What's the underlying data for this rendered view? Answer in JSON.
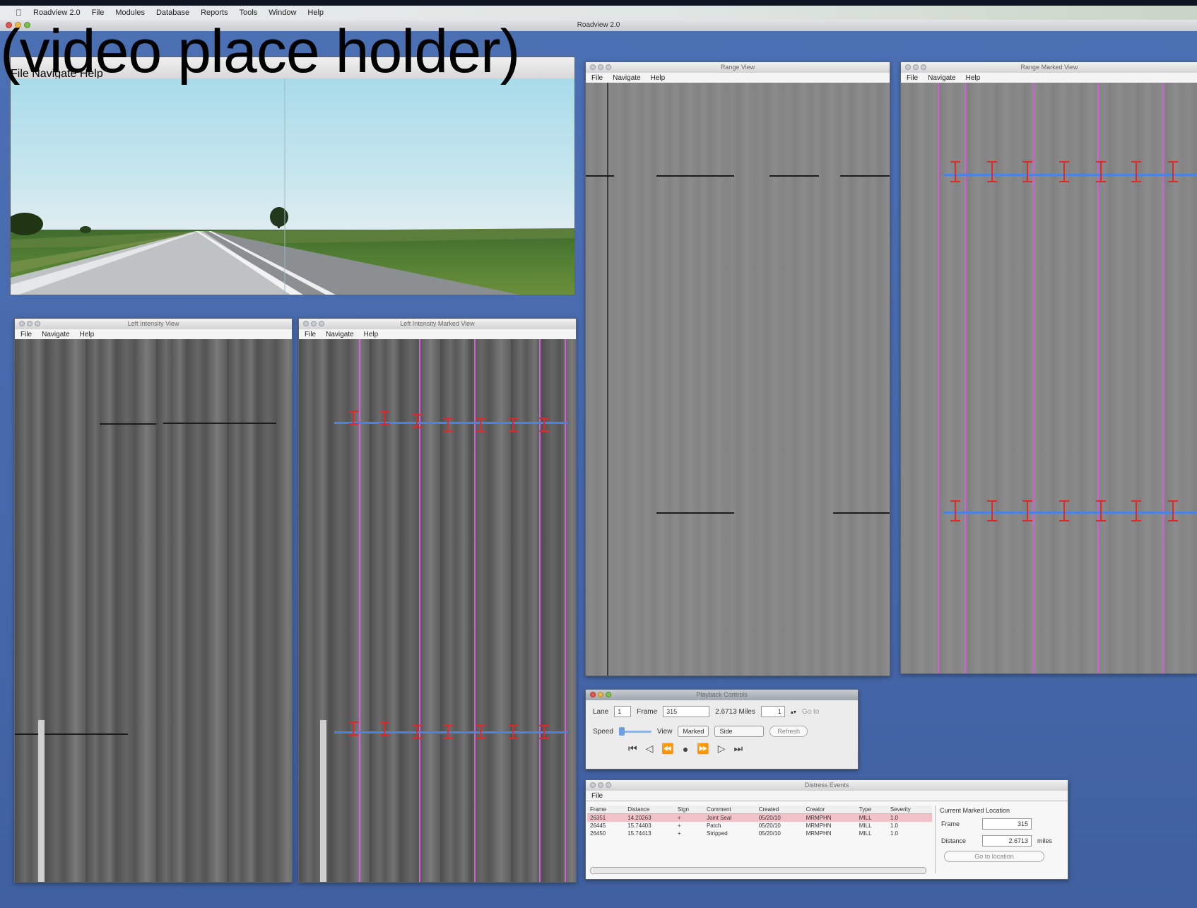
{
  "overlay_text": "(video place holder)",
  "menubar": {
    "apple": "",
    "items": [
      "Roadview 2.0",
      "File",
      "Modules",
      "Database",
      "Reports",
      "Tools",
      "Window",
      "Help"
    ]
  },
  "app_title": "Roadview 2.0",
  "video_window": {
    "menu": [
      "File",
      "Navigate",
      "Help"
    ]
  },
  "left_window": {
    "title": "Left Intensity View",
    "menu": [
      "File",
      "Navigate",
      "Help"
    ]
  },
  "marked_window": {
    "title": "Left Intensity Marked View",
    "menu": [
      "File",
      "Navigate",
      "Help"
    ]
  },
  "range_window": {
    "title": "Range View",
    "menu": [
      "File",
      "Navigate",
      "Help"
    ]
  },
  "range_marked_window": {
    "title": "Range Marked View",
    "menu": [
      "File",
      "Navigate",
      "Help"
    ]
  },
  "controls": {
    "title": "Playback Controls",
    "lane_label": "Lane",
    "lane_value": "1",
    "frame_label": "Frame",
    "frame_value": "315",
    "distance_value": "2.6713 Miles",
    "step_value": "1",
    "goto_label": "Go to",
    "speed_label": "Speed",
    "view_label": "View",
    "view_value": "Marked",
    "side_value": "Side",
    "refresh_label": "Refresh"
  },
  "events": {
    "title": "Distress Events",
    "menu": [
      "File"
    ],
    "columns": [
      "Frame",
      "Distance",
      "Sign",
      "Comment",
      "Created",
      "Creator",
      "Type",
      "Severity"
    ],
    "rows": [
      [
        "26351",
        "14.20263",
        "+",
        "Joint Seal",
        "05/20/10",
        "MRMPHN",
        "MILL",
        "1.0"
      ],
      [
        "26445",
        "15.74403",
        "+",
        "Patch",
        "05/20/10",
        "MRMPHN",
        "MILL",
        "1.0"
      ],
      [
        "26450",
        "15.74413",
        "+",
        "Stripped",
        "05/20/10",
        "MRMPHN",
        "MILL",
        "1.0"
      ]
    ],
    "side": {
      "heading": "Current Marked Location",
      "frame_label": "Frame",
      "frame_value": "315",
      "distance_label": "Distance",
      "distance_value": "2.6713",
      "distance_unit": "miles",
      "button": "Go to location"
    }
  },
  "colors": {
    "desktop": "#4a6fb0",
    "mark_line": "#d25ed9",
    "measure_line": "#4c82e0",
    "marker": "#e02a2a"
  }
}
